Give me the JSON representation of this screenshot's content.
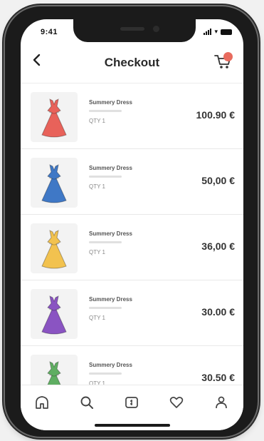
{
  "status_bar": {
    "time": "9:41"
  },
  "header": {
    "title": "Checkout",
    "back_icon": "chevron-left-icon",
    "cart_icon": "cart-icon"
  },
  "items": [
    {
      "name": "Summery Dress",
      "qty": "QTY 1",
      "price": "100.90 €",
      "dress_color": "#e8625a"
    },
    {
      "name": "Summery Dress",
      "qty": "QTY 1",
      "price": "50,00 €",
      "dress_color": "#3f78c6"
    },
    {
      "name": "Summery Dress",
      "qty": "QTY 1",
      "price": "36,00 €",
      "dress_color": "#f2c24f"
    },
    {
      "name": "Summery Dress",
      "qty": "QTY 1",
      "price": "30.00 €",
      "dress_color": "#8a54c2"
    },
    {
      "name": "Summery Dress",
      "qty": "QTY 1",
      "price": "30.50 €",
      "dress_color": "#5fae62"
    }
  ],
  "tabbar": {
    "items": [
      {
        "icon": "home-icon"
      },
      {
        "icon": "search-icon"
      },
      {
        "icon": "wallet-icon"
      },
      {
        "icon": "heart-icon"
      },
      {
        "icon": "profile-icon"
      }
    ]
  },
  "colors": {
    "accent": "#e86b5e",
    "text": "#2a2a2a",
    "divider": "#e8e8e8"
  }
}
